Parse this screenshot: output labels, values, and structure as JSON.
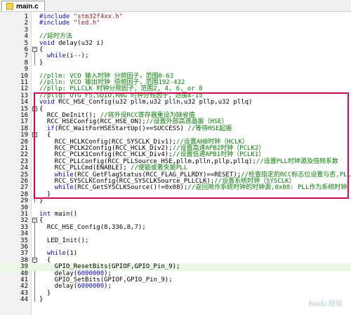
{
  "tab": {
    "filename": "main.c"
  },
  "lines": [
    {
      "n": "1",
      "spans": [
        {
          "t": "#include ",
          "c": "kw"
        },
        {
          "t": "\"stm32f4xx.h\"",
          "c": "st"
        }
      ]
    },
    {
      "n": "2",
      "spans": [
        {
          "t": "#include ",
          "c": "kw"
        },
        {
          "t": "\"led.h\"",
          "c": "st"
        }
      ]
    },
    {
      "n": "3",
      "spans": []
    },
    {
      "n": "4",
      "spans": [
        {
          "t": "//延时方法",
          "c": "cm"
        }
      ]
    },
    {
      "n": "5",
      "spans": [
        {
          "t": "void ",
          "c": "kw"
        },
        {
          "t": "delay(u32 i)",
          "c": ""
        }
      ]
    },
    {
      "n": "6",
      "spans": [
        {
          "t": "{",
          "c": ""
        }
      ]
    },
    {
      "n": "7",
      "spans": [
        {
          "t": "  ",
          "c": ""
        },
        {
          "t": "while",
          "c": "kw"
        },
        {
          "t": "(i--);",
          "c": ""
        }
      ]
    },
    {
      "n": "8",
      "spans": [
        {
          "t": "}",
          "c": ""
        }
      ]
    },
    {
      "n": "9",
      "spans": []
    },
    {
      "n": "10",
      "spans": [
        {
          "t": "//pllm: VCO 输入时钟 分频因子，范围0-63",
          "c": "cm"
        }
      ]
    },
    {
      "n": "11",
      "spans": [
        {
          "t": "//plln: VCO 输出时钟 倍频因子，范围192-432",
          "c": "cm"
        }
      ]
    },
    {
      "n": "12",
      "spans": [
        {
          "t": "//pllp: PLLCLK 时钟分频因子，范围2, 4, 6, or 8",
          "c": "cm"
        }
      ]
    },
    {
      "n": "13",
      "spans": [
        {
          "t": "//pllq: OTG FS,SDIO,RNG 时钟分频因子，范围4-15",
          "c": "cm"
        }
      ]
    },
    {
      "n": "14",
      "spans": [
        {
          "t": "void ",
          "c": "kw"
        },
        {
          "t": "RCC_HSE_Config(u32 pllm,u32 plln,u32 pllp,u32 pllq)",
          "c": ""
        }
      ]
    },
    {
      "n": "15",
      "spans": [
        {
          "t": "{",
          "c": ""
        }
      ]
    },
    {
      "n": "16",
      "spans": [
        {
          "t": "  RCC_DeInit(); ",
          "c": ""
        },
        {
          "t": "//将外设RCC寄存器重设为缺省值",
          "c": "cm"
        }
      ]
    },
    {
      "n": "17",
      "spans": [
        {
          "t": "  RCC_HSEConfig(RCC_HSE_ON);",
          "c": ""
        },
        {
          "t": "//设置外部高速晶振（HSE）",
          "c": "cm"
        }
      ]
    },
    {
      "n": "18",
      "spans": [
        {
          "t": "  ",
          "c": ""
        },
        {
          "t": "if",
          "c": "kw"
        },
        {
          "t": "(RCC_WaitForHSEStartUp()==SUCCESS) ",
          "c": ""
        },
        {
          "t": "//等待HSE起振",
          "c": "cm"
        }
      ]
    },
    {
      "n": "19",
      "spans": [
        {
          "t": "  {",
          "c": ""
        }
      ]
    },
    {
      "n": "20",
      "spans": [
        {
          "t": "    RCC_HCLKConfig(RCC_SYSCLK_Div1);",
          "c": ""
        },
        {
          "t": "//设置AHB时钟（HCLK）",
          "c": "cm"
        }
      ]
    },
    {
      "n": "21",
      "spans": [
        {
          "t": "    RCC_PCLK2Config(RCC_HCLK_Div2);",
          "c": ""
        },
        {
          "t": "//设置高速APB2时钟（PCLK2）",
          "c": "cm"
        }
      ]
    },
    {
      "n": "22",
      "spans": [
        {
          "t": "    RCC_PCLK1Config(RCC_HCLK_Div4);",
          "c": ""
        },
        {
          "t": "//设置低速APB1时钟（PCLK1）",
          "c": "cm"
        }
      ]
    },
    {
      "n": "23",
      "spans": [
        {
          "t": "    RCC_PLLConfig(RCC_PLLSource_HSE,pllm,plln,pllp,pllq);",
          "c": ""
        },
        {
          "t": "//设置PLL时钟源及倍频系数",
          "c": "cm"
        }
      ]
    },
    {
      "n": "24",
      "spans": [
        {
          "t": "    RCC_PLLCmd(ENABLE); ",
          "c": ""
        },
        {
          "t": "//使能或者失能PLL",
          "c": "cm"
        }
      ]
    },
    {
      "n": "25",
      "spans": [
        {
          "t": "    ",
          "c": ""
        },
        {
          "t": "while",
          "c": "kw"
        },
        {
          "t": "(RCC_GetFlagStatus(RCC_FLAG_PLLRDY)==RESET);",
          "c": ""
        },
        {
          "t": "//检查指定的RCC标志位设置与否,PLL就绪",
          "c": "cm"
        }
      ]
    },
    {
      "n": "26",
      "spans": [
        {
          "t": "    RCC_SYSCLKConfig(RCC_SYSCLKSource_PLLCLK);",
          "c": ""
        },
        {
          "t": "//设置系统时钟（SYSCLK）",
          "c": "cm"
        }
      ]
    },
    {
      "n": "27",
      "spans": [
        {
          "t": "    ",
          "c": ""
        },
        {
          "t": "while",
          "c": "kw"
        },
        {
          "t": "(RCC_GetSYSCLKSource()!=0x08);",
          "c": ""
        },
        {
          "t": "//返回用作系统时钟的时钟源,0x08: PLL作为系统时钟",
          "c": "cm"
        }
      ]
    },
    {
      "n": "28",
      "spans": [
        {
          "t": "  }",
          "c": ""
        }
      ]
    },
    {
      "n": "29",
      "spans": [
        {
          "t": "}",
          "c": ""
        }
      ]
    },
    {
      "n": "30",
      "spans": []
    },
    {
      "n": "31",
      "spans": [
        {
          "t": "int ",
          "c": "kw"
        },
        {
          "t": "main()",
          "c": ""
        }
      ]
    },
    {
      "n": "32",
      "spans": [
        {
          "t": "{",
          "c": ""
        }
      ]
    },
    {
      "n": "33",
      "spans": [
        {
          "t": "  RCC_HSE_Config(8,336,8,7);",
          "c": ""
        }
      ]
    },
    {
      "n": "34",
      "spans": []
    },
    {
      "n": "35",
      "spans": [
        {
          "t": "  LED_Init();",
          "c": ""
        }
      ]
    },
    {
      "n": "36",
      "spans": []
    },
    {
      "n": "37",
      "spans": [
        {
          "t": "  ",
          "c": ""
        },
        {
          "t": "while",
          "c": "kw"
        },
        {
          "t": "(1)",
          "c": ""
        }
      ]
    },
    {
      "n": "38",
      "spans": [
        {
          "t": "  {",
          "c": ""
        }
      ]
    },
    {
      "n": "39",
      "spans": [
        {
          "t": "    GPIO_ResetBits(GPIOF,GPIO_Pin_9);",
          "c": ""
        }
      ],
      "highlight": true
    },
    {
      "n": "40",
      "spans": [
        {
          "t": "    delay(",
          "c": ""
        },
        {
          "t": "6000000",
          "c": "kw"
        },
        {
          "t": ");",
          "c": ""
        }
      ]
    },
    {
      "n": "41",
      "spans": [
        {
          "t": "    GPIO_SetBits(GPIOF,GPIO_Pin_9);",
          "c": ""
        }
      ]
    },
    {
      "n": "42",
      "spans": [
        {
          "t": "    delay(",
          "c": ""
        },
        {
          "t": "6000000",
          "c": "kw"
        },
        {
          "t": ");",
          "c": ""
        }
      ]
    },
    {
      "n": "43",
      "spans": [
        {
          "t": "  }",
          "c": ""
        }
      ]
    },
    {
      "n": "44",
      "spans": [
        {
          "t": "}",
          "c": ""
        }
      ]
    }
  ],
  "colors": {
    "highlight_box": "#e8004c",
    "keyword": "#0000ff",
    "comment": "#008000",
    "string": "#a31515"
  }
}
